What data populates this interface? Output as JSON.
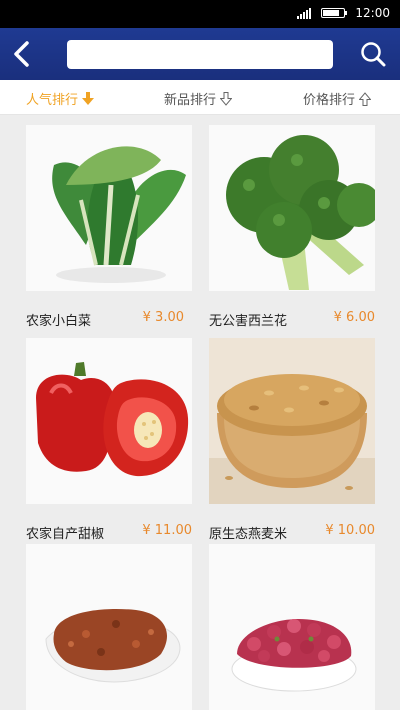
{
  "status_bar": {
    "time": "12:00"
  },
  "header": {
    "search": {
      "value": "",
      "placeholder": ""
    }
  },
  "sort_tabs": [
    {
      "label": "人气排行",
      "active": true
    },
    {
      "label": "新品排行",
      "active": false
    },
    {
      "label": "价格排行",
      "active": false
    }
  ],
  "products": [
    {
      "name": "农家小白菜",
      "price": "¥ 3.00",
      "image": "bok-choy"
    },
    {
      "name": "无公害西兰花",
      "price": "¥ 6.00",
      "image": "broccoli"
    },
    {
      "name": "农家自产甜椒",
      "price": "¥ 11.00",
      "image": "red-bell-pepper"
    },
    {
      "name": "原生态燕麦米",
      "price": "¥ 10.00",
      "image": "oat-rice-bowl"
    },
    {
      "name": "",
      "price": "",
      "image": "dried-spice-spoon"
    },
    {
      "name": "",
      "price": "",
      "image": "rose-bud-tea-bowl"
    }
  ],
  "colors": {
    "header": "#1f3a92",
    "accent": "#f0a324",
    "price": "#e8892c"
  }
}
